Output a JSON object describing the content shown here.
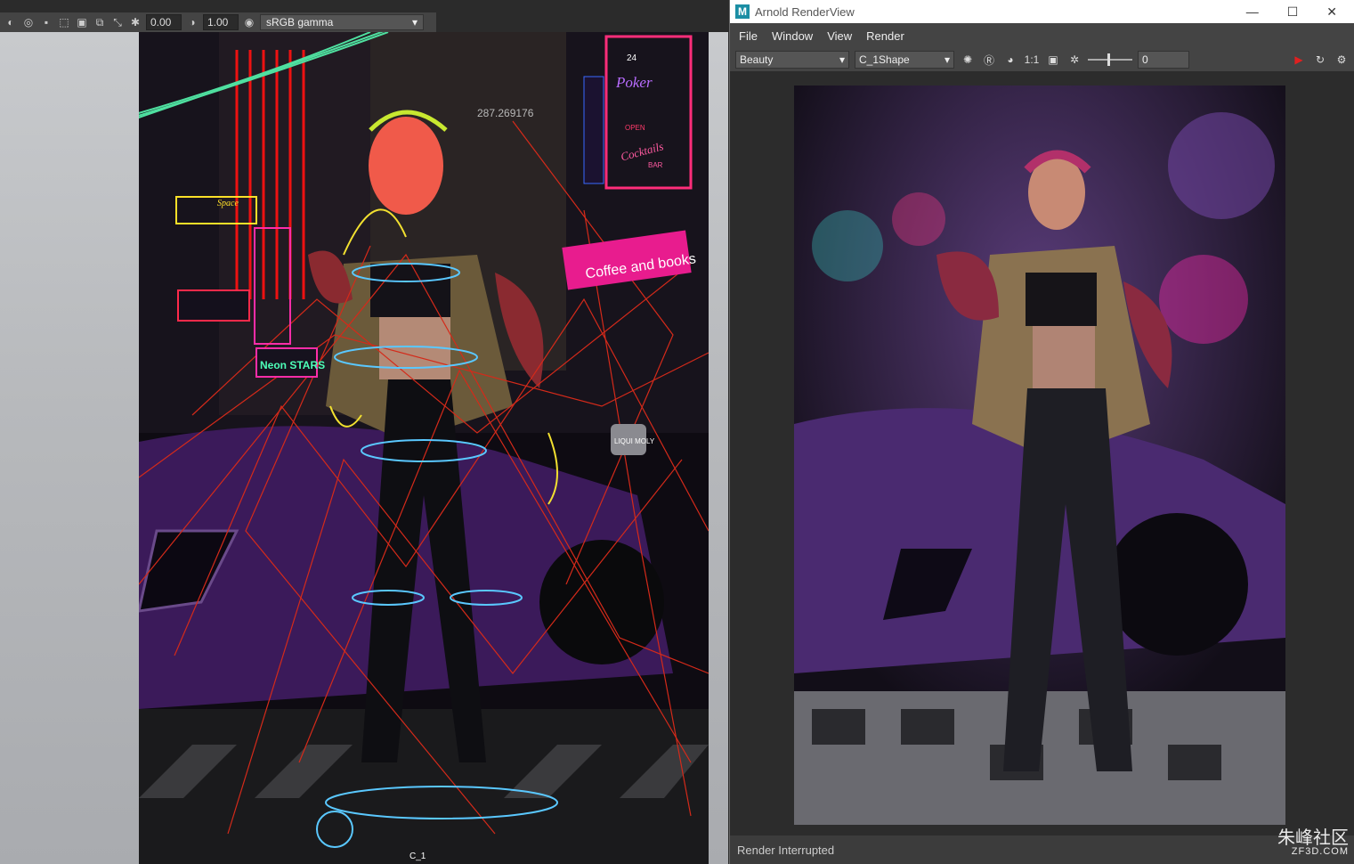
{
  "viewport": {
    "exposure_value": "0.00",
    "gamma_value": "1.00",
    "colorspace": "sRGB gamma",
    "camera_label": "C_1",
    "coord_text": "287.269176"
  },
  "renderview": {
    "title": "Arnold RenderView",
    "logo": "M",
    "menus": [
      "File",
      "Window",
      "View",
      "Render"
    ],
    "aov": "Beauty",
    "camera": "C_1Shape",
    "zoom": "1:1",
    "exposure": "0",
    "status": "Render Interrupted"
  },
  "signs": {
    "poker": "Poker",
    "coffee": "Coffee and books",
    "neon_stars": "Neon STARS",
    "space": "Space",
    "liqui": "LIQUI MOLY",
    "cocktails": "Cocktails",
    "open": "OPEN",
    "bar": "BAR",
    "number": "24"
  },
  "watermark": {
    "logo": "朱峰社区",
    "url": "ZF3D.COM"
  }
}
